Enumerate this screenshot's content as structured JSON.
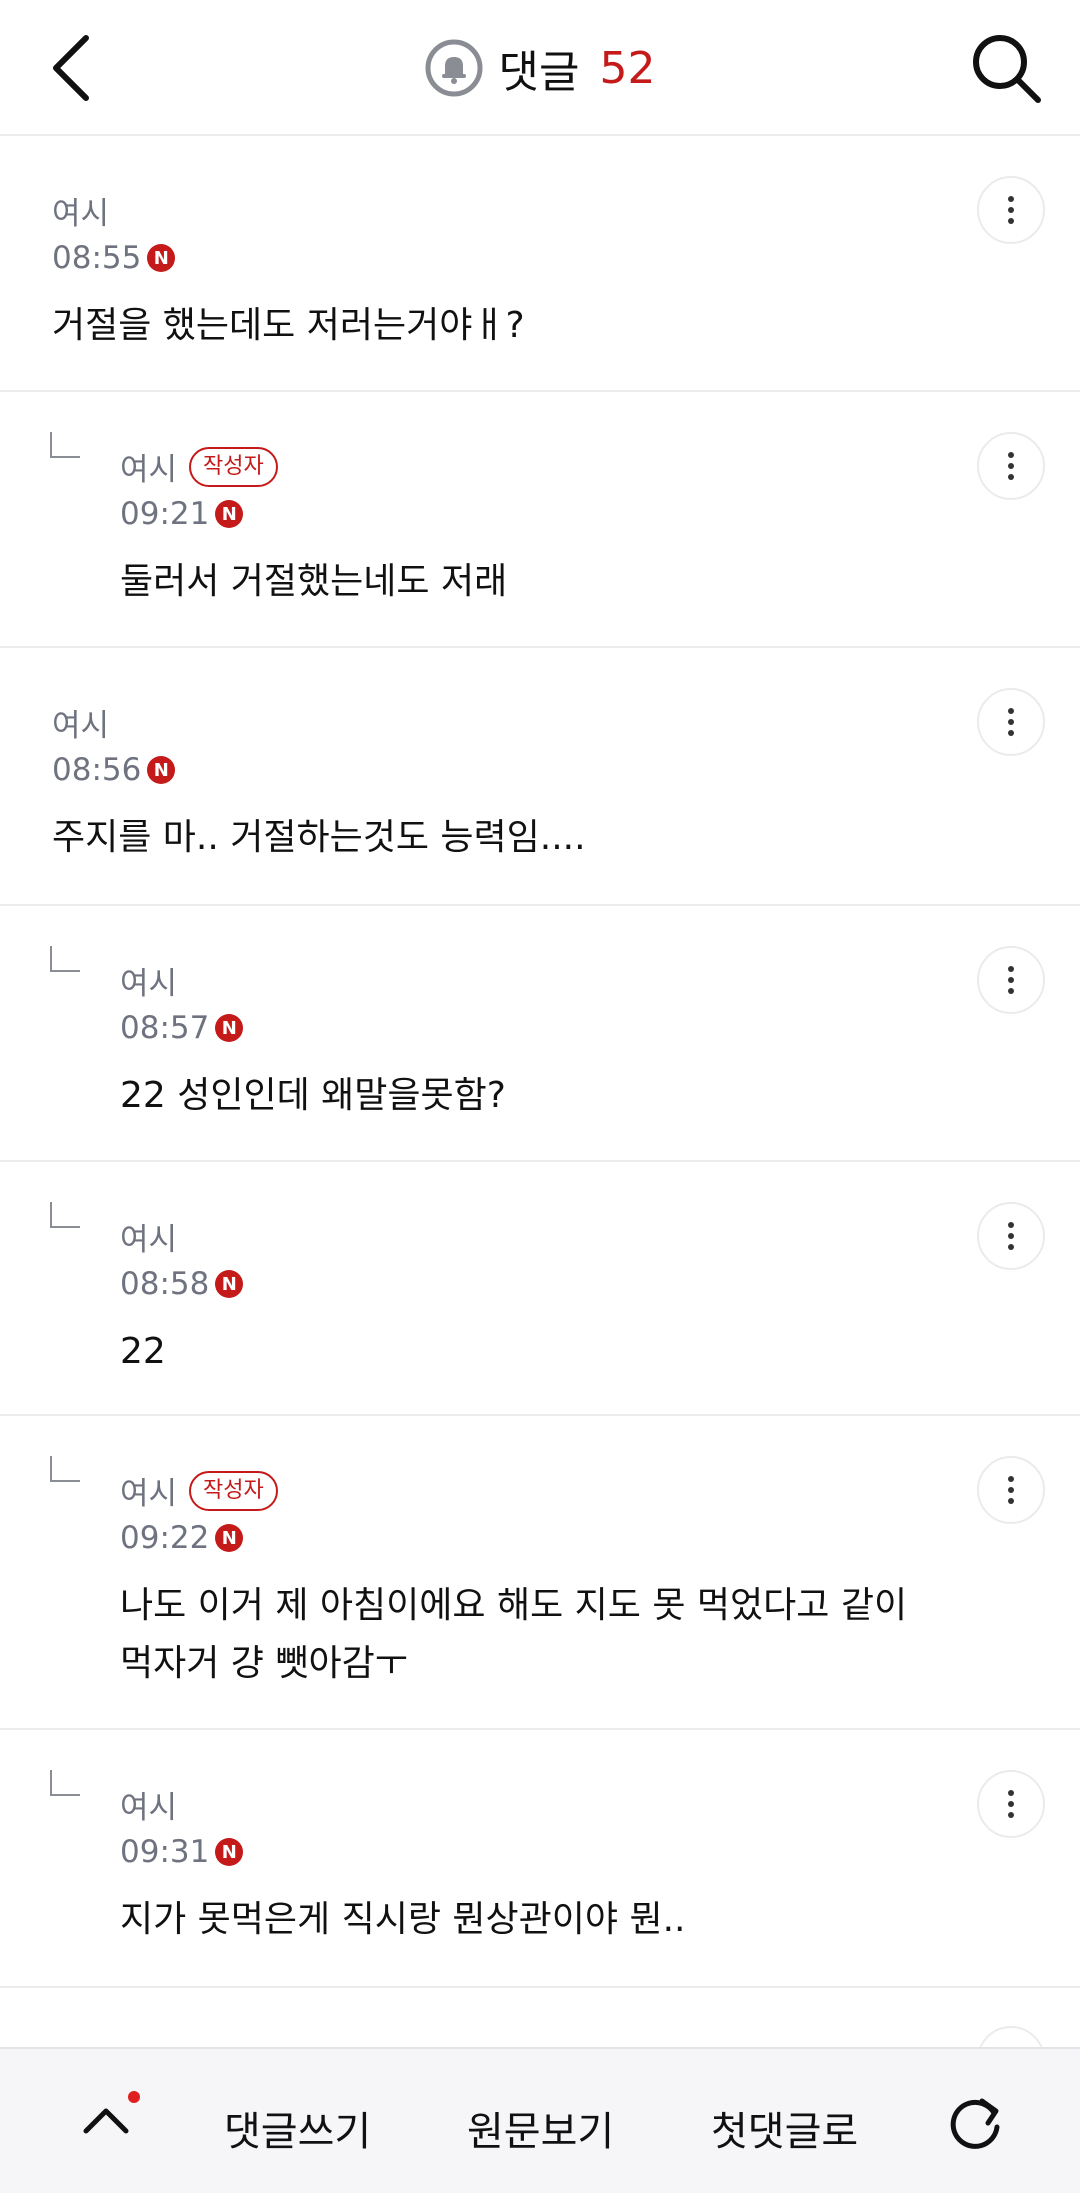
{
  "header": {
    "title": "댓글",
    "count": "52"
  },
  "comments": [
    {
      "author": "여시",
      "time": "08:55",
      "new_badge": "N",
      "text": "거절을 했는데도 저러는거야ㅐ?"
    },
    {
      "author": "여시",
      "badge": "작성자",
      "time": "09:21",
      "new_badge": "N",
      "text": "둘러서 거절했는네도 저래"
    },
    {
      "author": "여시",
      "time": "08:56",
      "new_badge": "N",
      "text": "주지를 마.. 거절하는것도 능력임...."
    },
    {
      "author": "여시",
      "time": "08:57",
      "new_badge": "N",
      "text": "22 성인인데 왜말을못함?"
    },
    {
      "author": "여시",
      "time": "08:58",
      "new_badge": "N",
      "text": "22"
    },
    {
      "author": "여시",
      "badge": "작성자",
      "time": "09:22",
      "new_badge": "N",
      "text_line1": "나도 이거 제 아침이에요 해도 지도 못 먹었다고 같이",
      "text_line2": "먹자거 걍 뺏아감ㅜ"
    },
    {
      "author": "여시",
      "time": "09:31",
      "new_badge": "N",
      "text": "지가 못먹은게 직시랑 뭔상관이야 뭔.."
    }
  ],
  "bottom_bar": {
    "write": "댓글쓰기",
    "view_original": "원문보기",
    "first_comment": "첫댓글로"
  },
  "colors": {
    "accent": "#c41a1a",
    "meta_text": "#6f7380",
    "divider": "#ececec"
  },
  "icons": [
    "back-icon",
    "bell-icon",
    "search-icon",
    "more-icon",
    "reply-indent-icon",
    "chevron-up-icon",
    "refresh-icon"
  ]
}
